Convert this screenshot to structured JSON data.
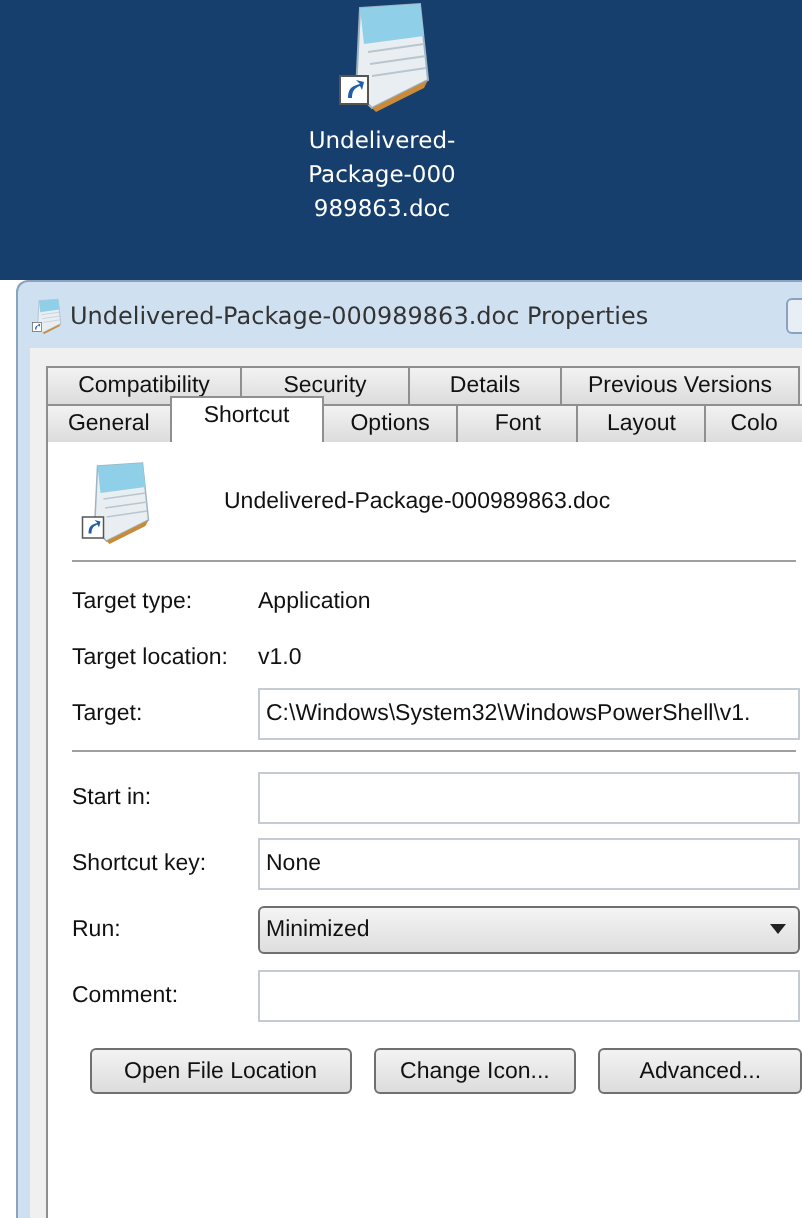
{
  "desktop_icon": {
    "label_lines": [
      "Undelivered-",
      "Package-000",
      "989863.doc"
    ]
  },
  "window": {
    "title": "Undelivered-Package-000989863.doc Properties"
  },
  "tab_rows": [
    [
      {
        "label": "Compatibility",
        "selected": false
      },
      {
        "label": "Security",
        "selected": false
      },
      {
        "label": "Details",
        "selected": false
      },
      {
        "label": "Previous Versions",
        "selected": false
      }
    ],
    [
      {
        "label": "General",
        "selected": false
      },
      {
        "label": "Shortcut",
        "selected": true
      },
      {
        "label": "Options",
        "selected": false
      },
      {
        "label": "Font",
        "selected": false
      },
      {
        "label": "Layout",
        "selected": false
      },
      {
        "label": "Colo",
        "selected": false
      }
    ]
  ],
  "file_name": "Undelivered-Package-000989863.doc",
  "groups": [
    [
      {
        "kind": "info",
        "label": "Target type:",
        "value": "Application"
      },
      {
        "kind": "info",
        "label": "Target location:",
        "value": "v1.0"
      },
      {
        "kind": "field",
        "label": "Target:",
        "value": "C:\\Windows\\System32\\WindowsPowerShell\\v1."
      }
    ],
    [
      {
        "kind": "field",
        "label": "Start in:"
      },
      {
        "kind": "field",
        "label": "Shortcut key:",
        "value": "None"
      },
      {
        "kind": "dropdown",
        "label": "Run:",
        "value": "Minimized"
      },
      {
        "kind": "field",
        "label": "Comment:"
      }
    ]
  ],
  "buttons": [
    "Open File Location",
    "Change Icon...",
    "Advanced..."
  ]
}
